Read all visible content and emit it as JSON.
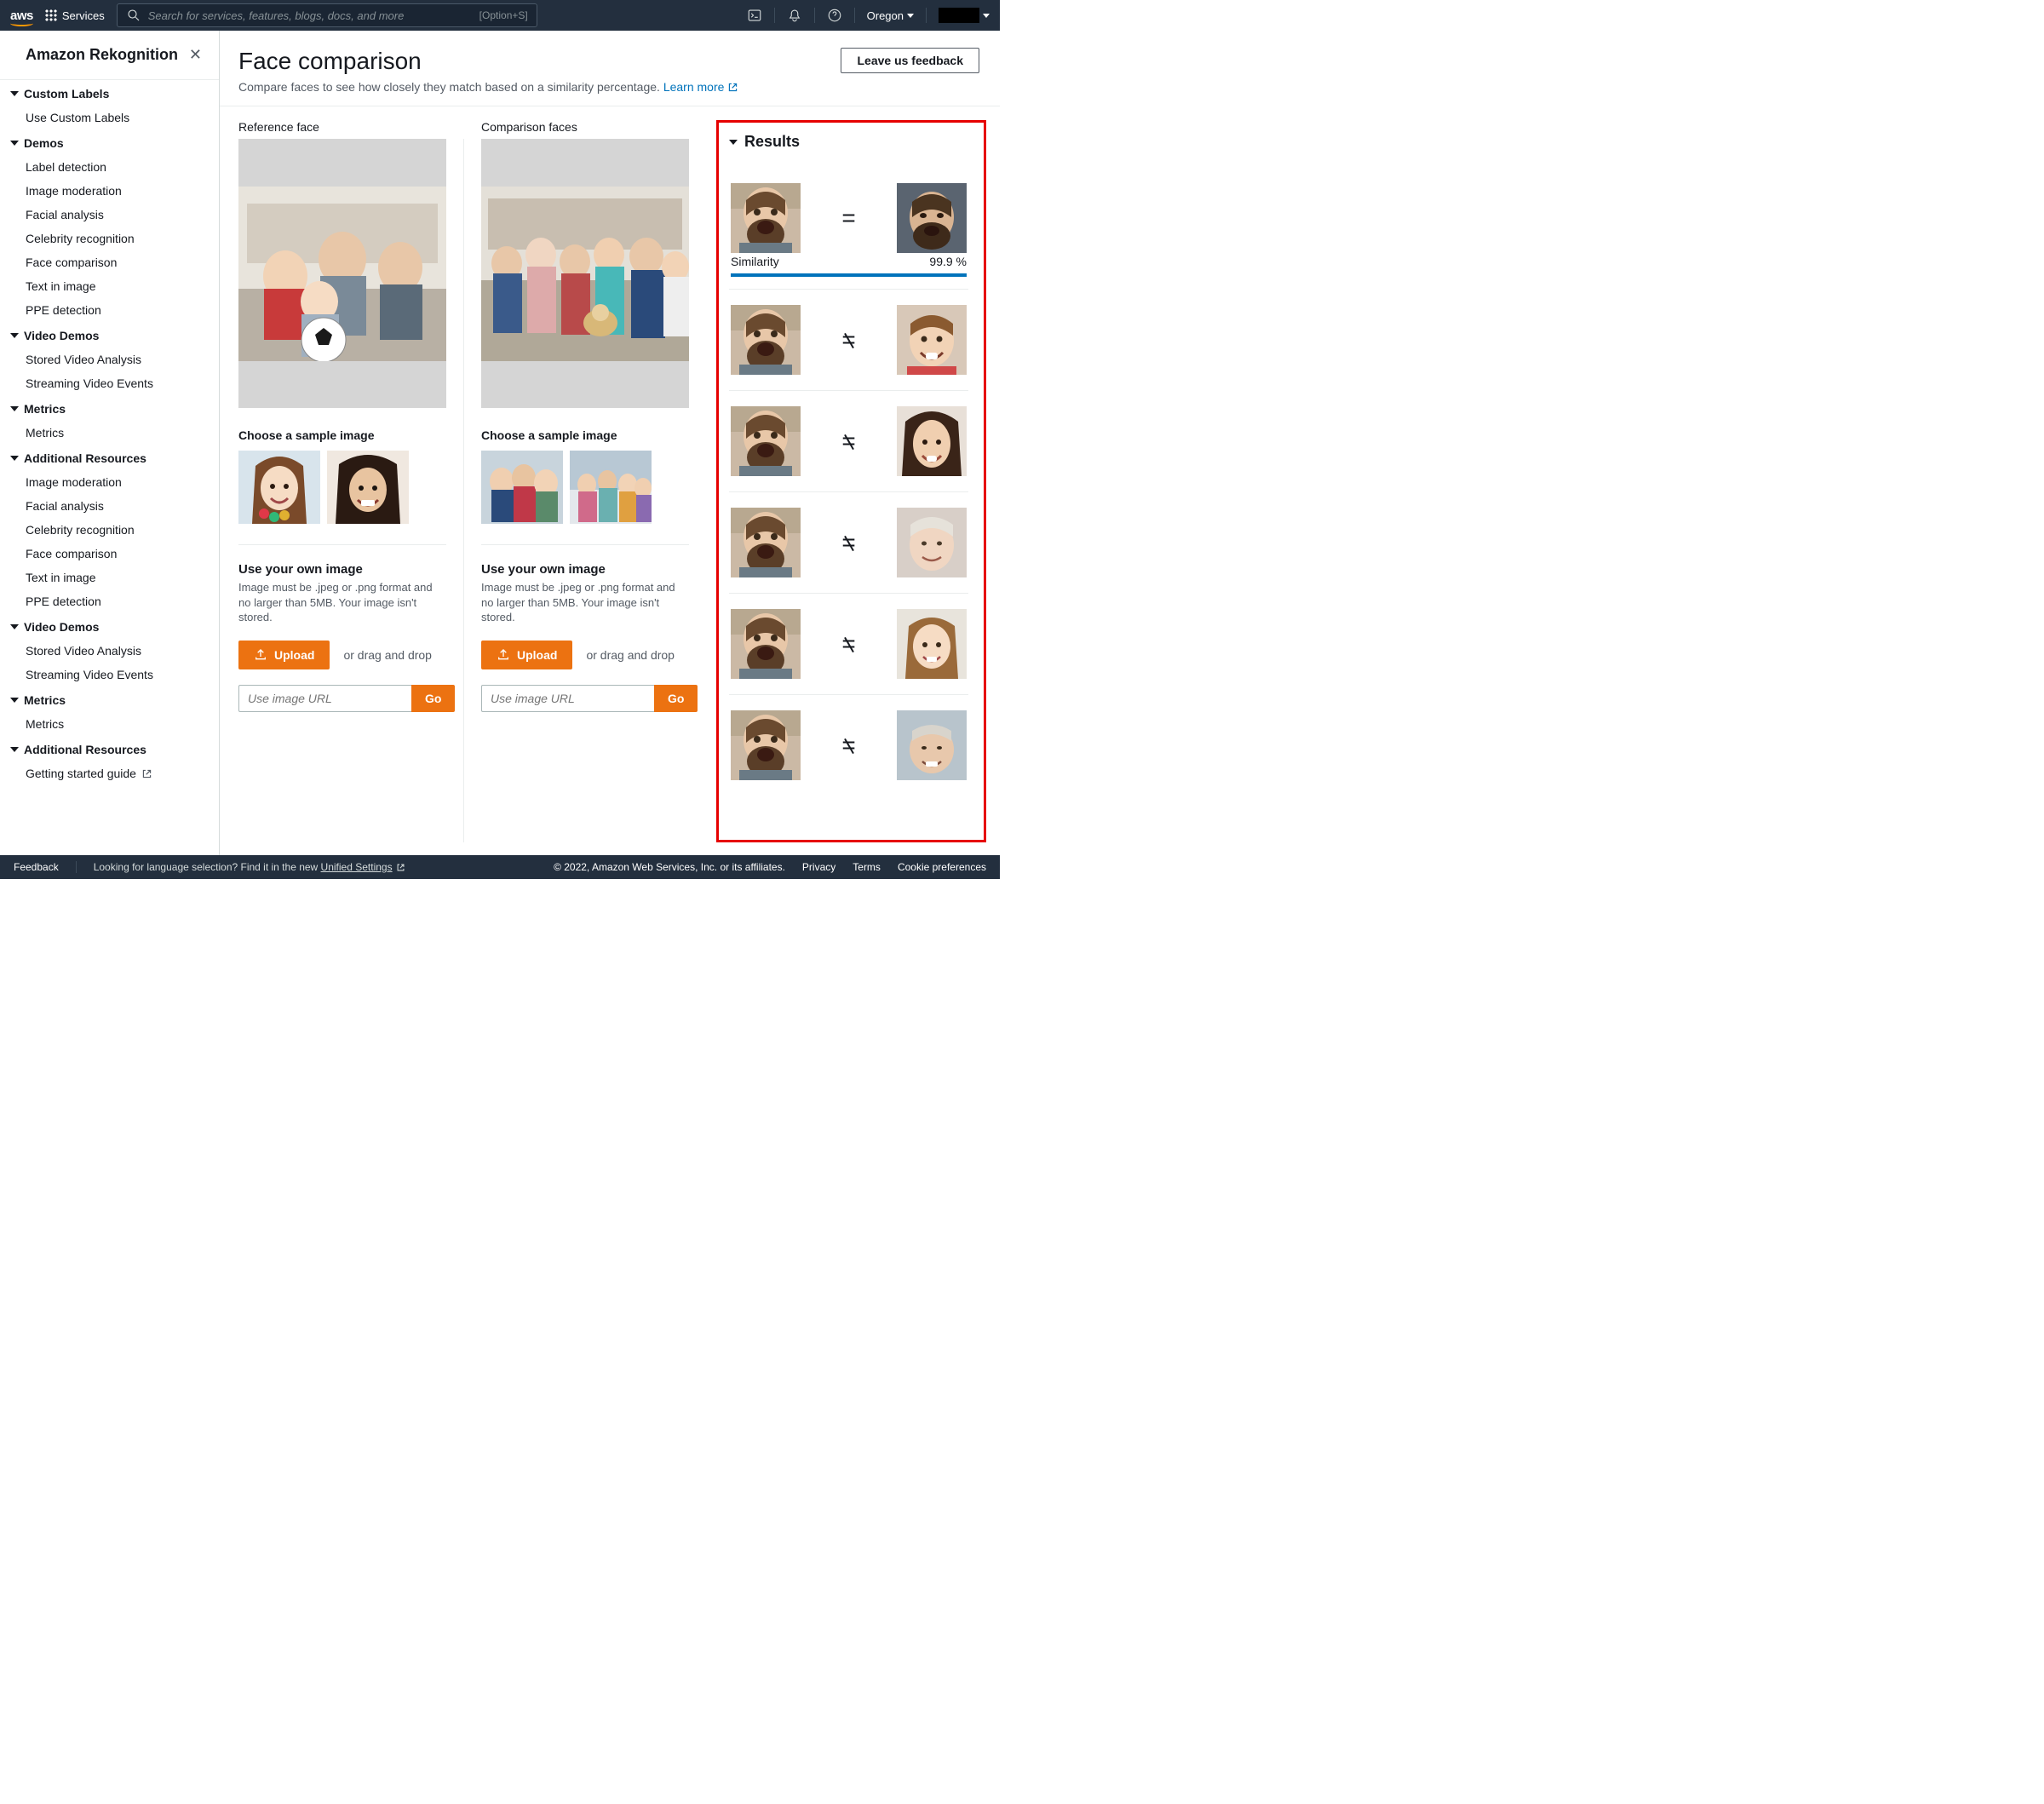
{
  "topnav": {
    "services_label": "Services",
    "search_placeholder": "Search for services, features, blogs, docs, and more",
    "search_shortcut": "[Option+S]",
    "region": "Oregon"
  },
  "sidebar": {
    "title": "Amazon Rekognition",
    "sections": [
      {
        "heading": "Custom Labels",
        "items": [
          "Use Custom Labels"
        ]
      },
      {
        "heading": "Demos",
        "items": [
          "Label detection",
          "Image moderation",
          "Facial analysis",
          "Celebrity recognition",
          "Face comparison",
          "Text in image",
          "PPE detection"
        ]
      },
      {
        "heading": "Video Demos",
        "items": [
          "Stored Video Analysis",
          "Streaming Video Events"
        ]
      },
      {
        "heading": "Metrics",
        "items": [
          "Metrics"
        ]
      },
      {
        "heading": "Additional Resources",
        "items": [
          "Image moderation",
          "Facial analysis",
          "Celebrity recognition",
          "Face comparison",
          "Text in image",
          "PPE detection"
        ]
      },
      {
        "heading": "Video Demos",
        "items": [
          "Stored Video Analysis",
          "Streaming Video Events"
        ]
      },
      {
        "heading": "Metrics",
        "items": [
          "Metrics"
        ]
      },
      {
        "heading": "Additional Resources",
        "items": [
          "Getting started guide"
        ],
        "external": [
          true
        ]
      }
    ]
  },
  "page": {
    "title": "Face comparison",
    "subtitle": "Compare faces to see how closely they match based on a similarity percentage.",
    "learn_more": "Learn more",
    "feedback_button": "Leave us feedback"
  },
  "reference": {
    "label": "Reference face",
    "sample_heading": "Choose a sample image",
    "own_heading": "Use your own image",
    "own_sub": "Image must be .jpeg or .png format and no larger than 5MB. Your image isn't stored.",
    "upload_label": "Upload",
    "drag_text": "or drag and drop",
    "url_placeholder": "Use image URL",
    "go_label": "Go"
  },
  "comparison": {
    "label": "Comparison faces",
    "sample_heading": "Choose a sample image",
    "own_heading": "Use your own image",
    "own_sub": "Image must be .jpeg or .png format and no larger than 5MB. Your image isn't stored.",
    "upload_label": "Upload",
    "drag_text": "or drag and drop",
    "url_placeholder": "Use image URL",
    "go_label": "Go"
  },
  "results": {
    "heading": "Results",
    "similarity_label": "Similarity",
    "rows": [
      {
        "match": true,
        "similarity": "99.9 %"
      },
      {
        "match": false
      },
      {
        "match": false
      },
      {
        "match": false
      },
      {
        "match": false
      },
      {
        "match": false
      }
    ]
  },
  "footer": {
    "feedback": "Feedback",
    "lang_hint_prefix": "Looking for language selection? Find it in the new ",
    "lang_hint_link": "Unified Settings",
    "copyright": "© 2022, Amazon Web Services, Inc. or its affiliates.",
    "links": [
      "Privacy",
      "Terms",
      "Cookie preferences"
    ]
  }
}
